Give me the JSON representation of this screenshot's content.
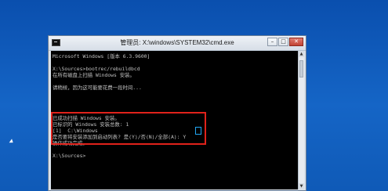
{
  "window": {
    "title": "管理员: X:\\windows\\SYSTEM32\\cmd.exe",
    "controls": {
      "minimize": "–",
      "maximize": "□",
      "close": "✕"
    }
  },
  "console": {
    "lines": [
      "Microsoft Windows [版本 6.3.9600]",
      "",
      "X:\\Sources>bootrec/rebuildbcd",
      "在所有磁盘上扫描 Windows 安装。",
      "",
      "请稍候，因为这可能要花费一段时间...",
      "",
      "已成功扫描 Windows 安装。",
      "已标识的 Windows 安装总数: 1",
      "[1]  C:\\Windows",
      "是否要将安装添加到启动列表? 是(Y)/否(N)/全部(A): Y",
      "操作成功完成。",
      "",
      "X:\\Sources>"
    ]
  },
  "colors": {
    "desktop": "#0f5cb8",
    "console_bg": "#000000",
    "console_text": "#c0c0c0",
    "highlight": "#e0221b",
    "input_highlight": "#21a7f3"
  }
}
